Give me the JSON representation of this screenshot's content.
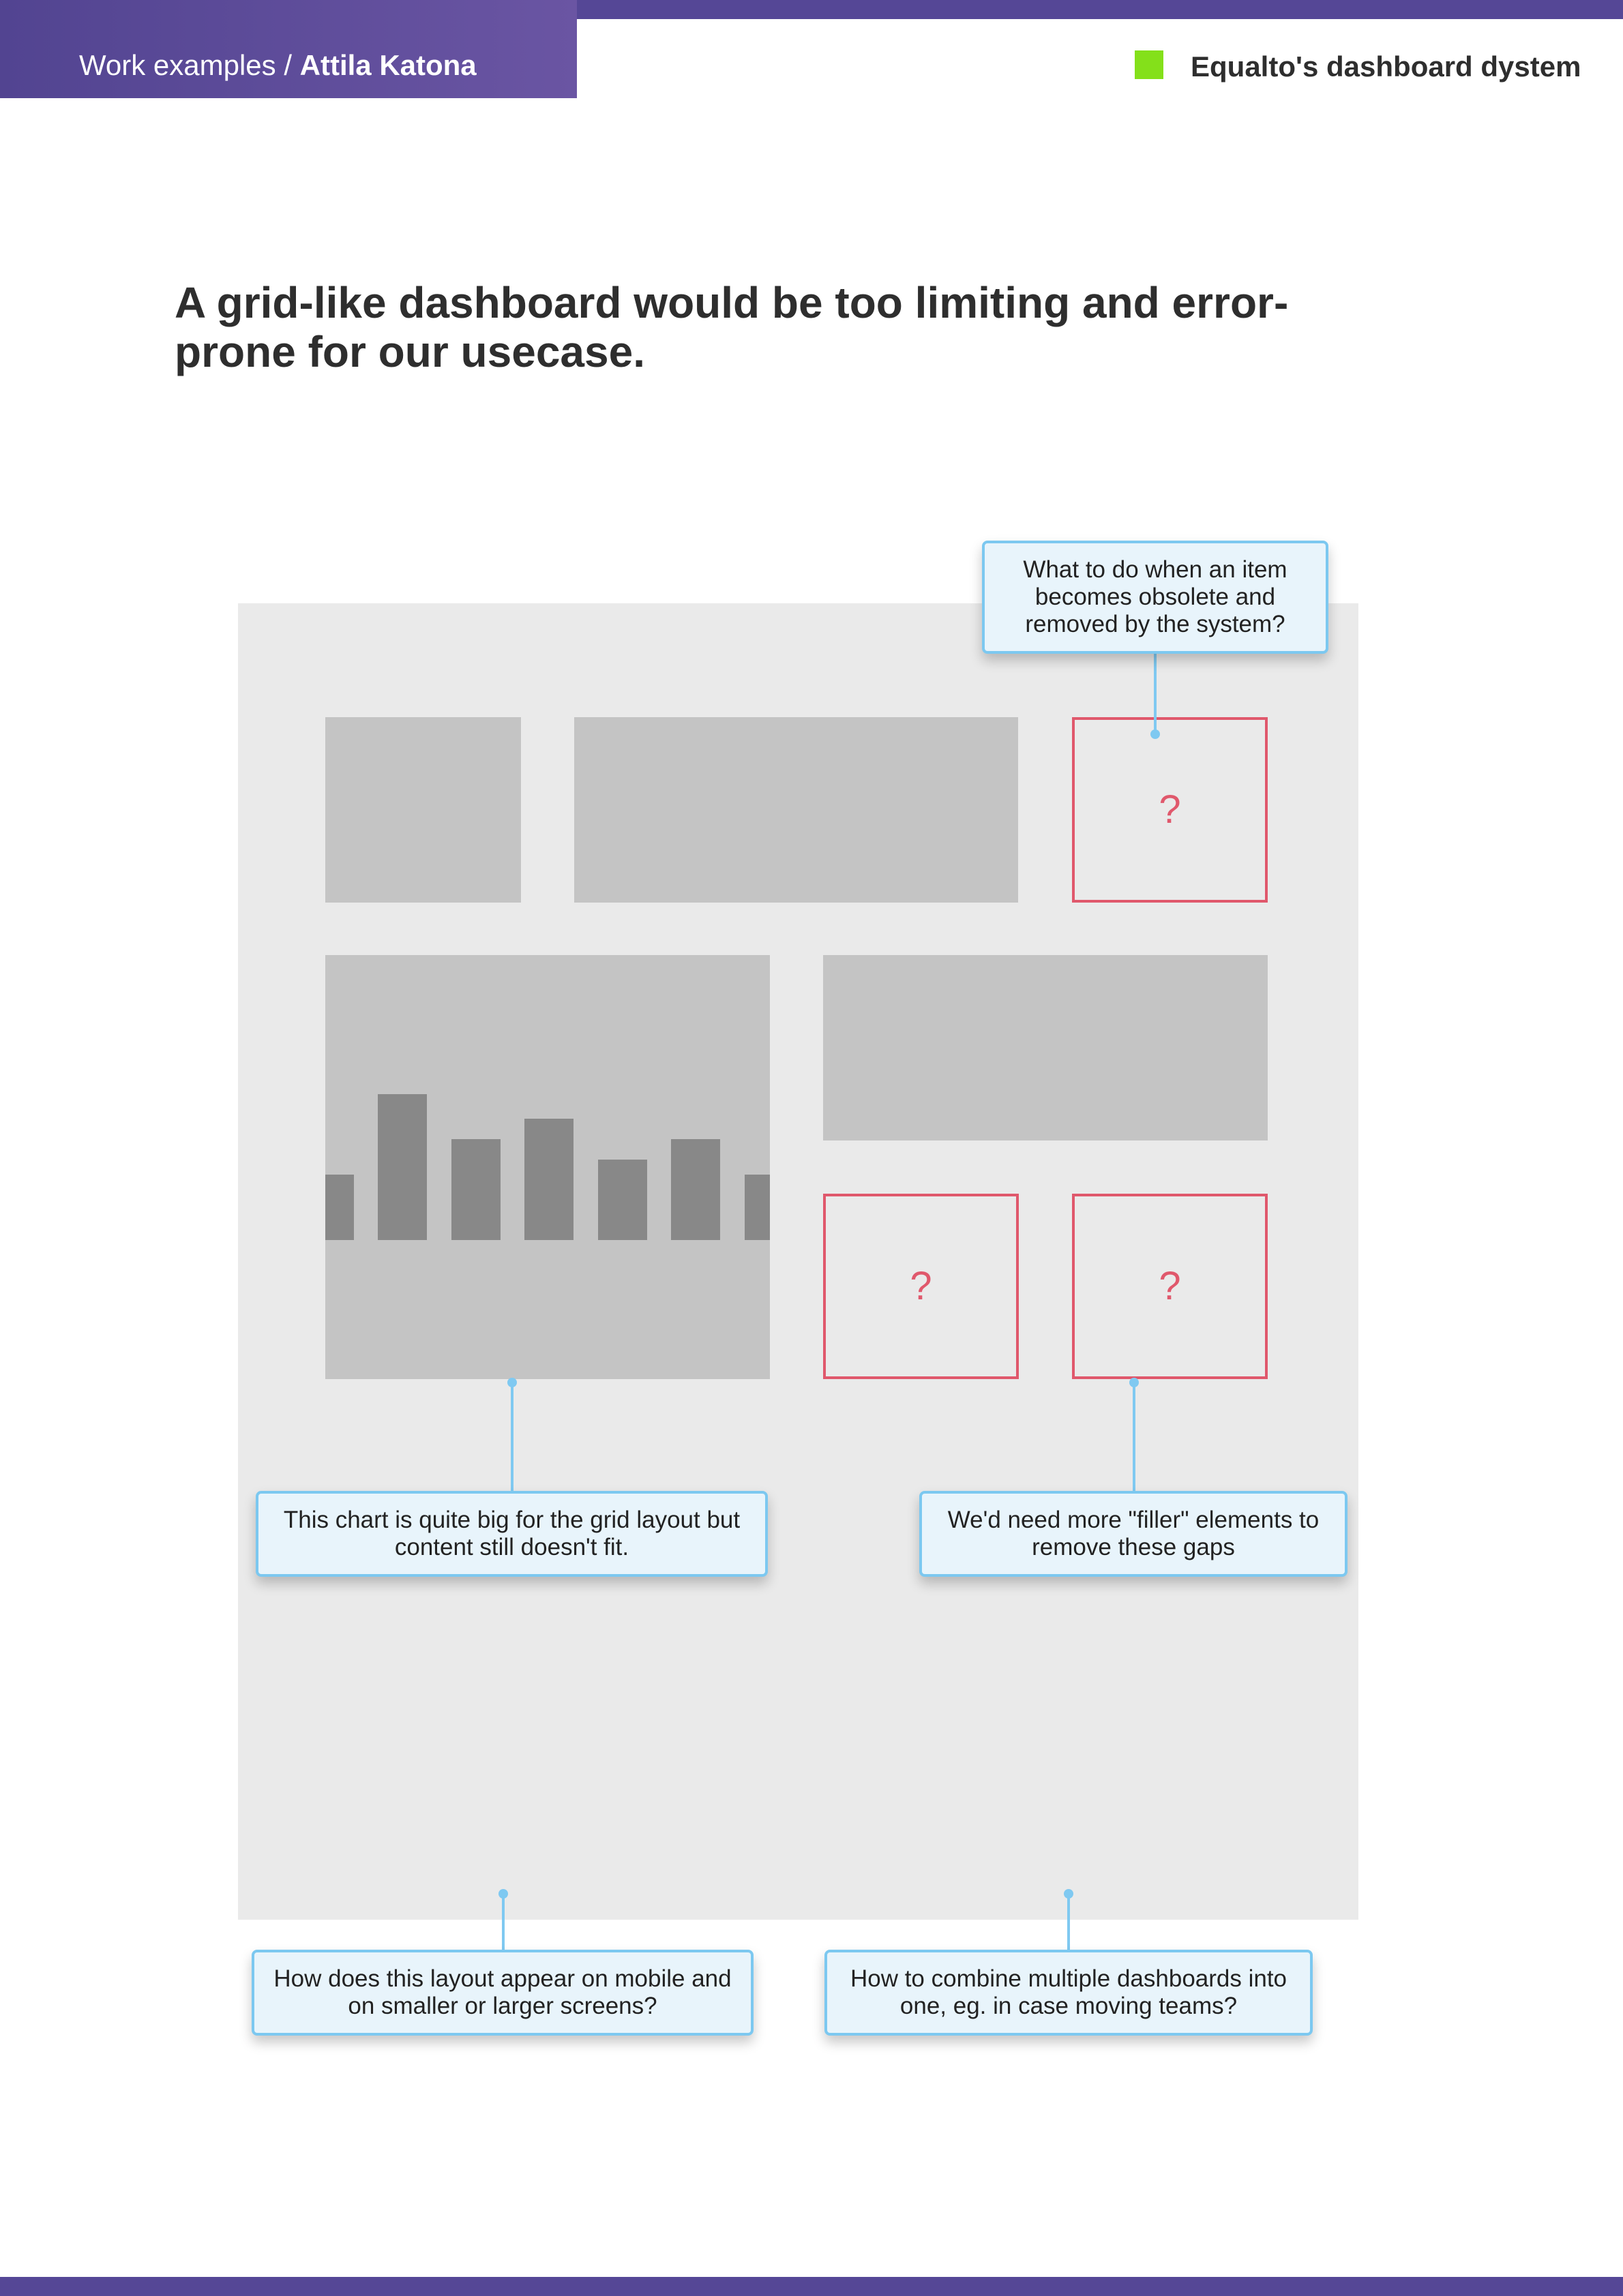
{
  "header": {
    "breadcrumb_prefix": "Work examples / ",
    "author": "Attila Katona",
    "project_title": "Equalto's dashboard dystem",
    "accent_color": "#84e01a",
    "brand_color": "#554796"
  },
  "heading": "A grid-like dashboard would be too limiting and error-prone for our usecase.",
  "diagram": {
    "question_mark": "?",
    "callouts": {
      "obsolete_item": "What to do when an item becomes obsolete and removed by the system?",
      "chart_too_big": "This chart is quite big for the grid layout but content still doesn't fit.",
      "filler_elements": "We'd need more \"filler\" elements to remove these gaps",
      "mobile_layout": "How does this layout appear on mobile and on smaller or larger screens?",
      "combine_dashboards": "How to combine multiple dashboards into one, eg. in case moving teams?"
    },
    "colors": {
      "canvas": "#eaeaea",
      "tile": "#c4c4c4",
      "bar": "#888888",
      "missing_tile_border": "#e0586c",
      "callout_border": "#7cc8f0",
      "callout_fill": "#e8f4fb"
    }
  }
}
